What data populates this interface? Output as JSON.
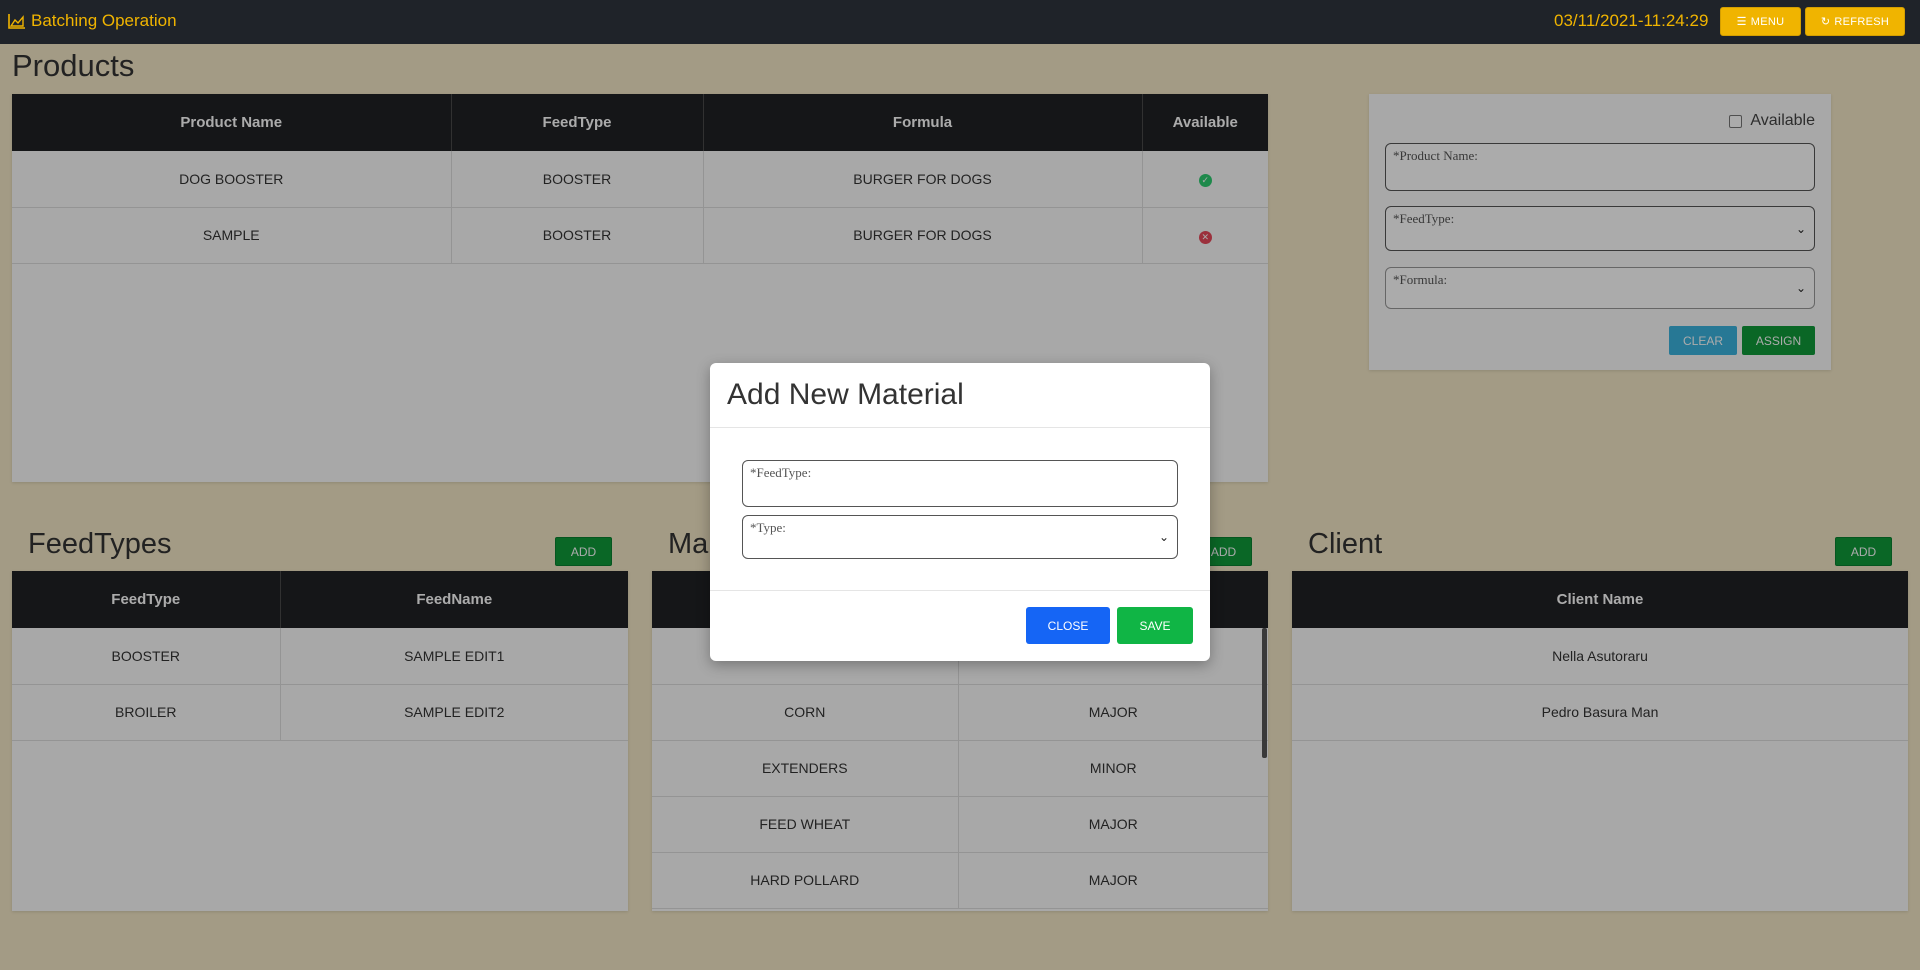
{
  "header": {
    "app_title": "Batching Operation",
    "datetime": "03/11/2021-11:24:29",
    "menu_label": "MENU",
    "refresh_label": "REFRESH",
    "accent_color": "#f0b400"
  },
  "products": {
    "title": "Products",
    "columns": [
      "Product Name",
      "FeedType",
      "Formula",
      "Available"
    ],
    "rows": [
      {
        "name": "DOG BOOSTER",
        "feedtype": "BOOSTER",
        "formula": "BURGER FOR DOGS",
        "available": true
      },
      {
        "name": "SAMPLE",
        "feedtype": "BOOSTER",
        "formula": "BURGER FOR DOGS",
        "available": false
      }
    ]
  },
  "product_form": {
    "available_label": "Available",
    "product_name_label": "*Product Name:",
    "feedtype_label": "*FeedType:",
    "formula_label": "*Formula:",
    "clear_label": "CLEAR",
    "assign_label": "ASSIGN"
  },
  "feedtypes": {
    "title": "FeedTypes",
    "add_label": "ADD",
    "columns": [
      "FeedType",
      "FeedName"
    ],
    "rows": [
      [
        "BOOSTER",
        "SAMPLE EDIT1"
      ],
      [
        "BROILER",
        "SAMPLE EDIT2"
      ]
    ]
  },
  "materials": {
    "title_visible": "Ma",
    "add_label": "ADD",
    "rows": [
      [
        "CORN",
        "MAJOR"
      ],
      [
        "EXTENDERS",
        "MINOR"
      ],
      [
        "FEED WHEAT",
        "MAJOR"
      ],
      [
        "HARD POLLARD",
        "MAJOR"
      ]
    ]
  },
  "client": {
    "title": "Client",
    "add_label": "ADD",
    "columns": [
      "Client Name"
    ],
    "rows": [
      "Nella Asutoraru",
      "Pedro Basura Man"
    ]
  },
  "modal": {
    "title": "Add New Material",
    "feedtype_label": "*FeedType:",
    "type_label": "*Type:",
    "close_label": "CLOSE",
    "save_label": "SAVE",
    "close_color": "#1565f5",
    "save_color": "#10b545"
  }
}
